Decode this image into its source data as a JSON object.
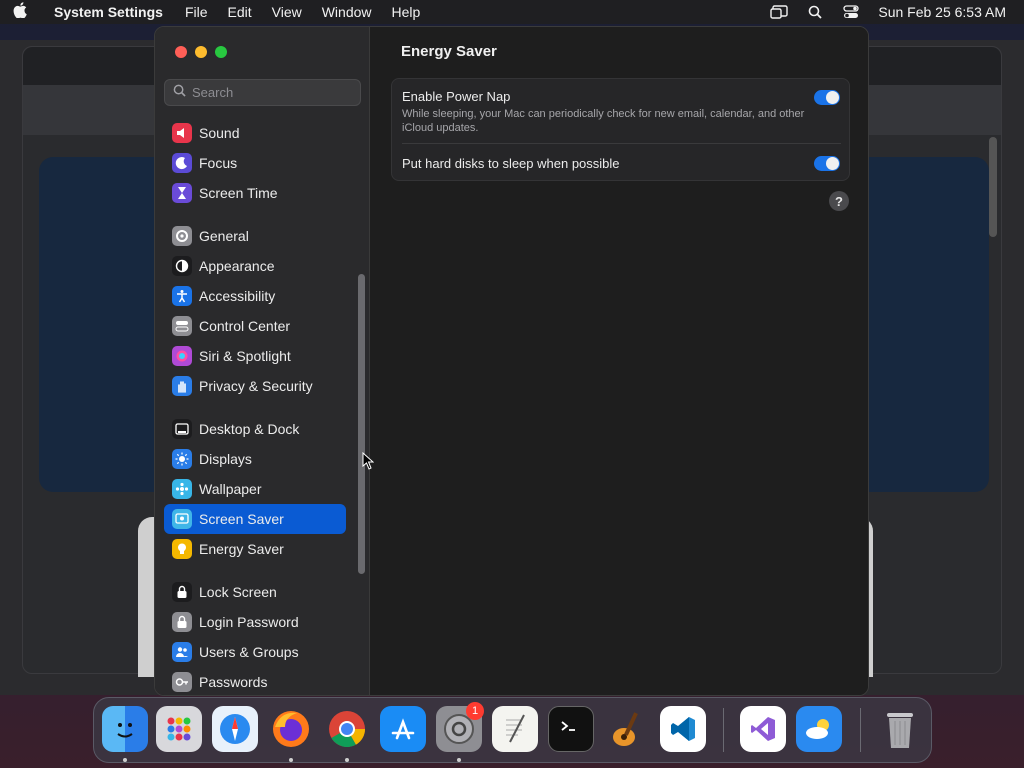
{
  "menubar": {
    "app_name": "System Settings",
    "menus": [
      "File",
      "Edit",
      "View",
      "Window",
      "Help"
    ],
    "clock": "Sun Feb 25  6:53 AM"
  },
  "sidebar": {
    "search_placeholder": "Search",
    "groups": [
      [
        {
          "label": "Sound",
          "icon": "speaker-icon",
          "color": "#e8354b"
        },
        {
          "label": "Focus",
          "icon": "moon-icon",
          "color": "#5b4bd6"
        },
        {
          "label": "Screen Time",
          "icon": "hourglass-icon",
          "color": "#6a4bd8"
        }
      ],
      [
        {
          "label": "General",
          "icon": "gear-icon",
          "color": "#8e8e93"
        },
        {
          "label": "Appearance",
          "icon": "appearance-icon",
          "color": "#1c1c1e"
        },
        {
          "label": "Accessibility",
          "icon": "accessibility-icon",
          "color": "#1a73e8"
        },
        {
          "label": "Control Center",
          "icon": "control-center-icon",
          "color": "#8e8e93"
        },
        {
          "label": "Siri & Spotlight",
          "icon": "siri-icon",
          "color": "#b04ad6"
        },
        {
          "label": "Privacy & Security",
          "icon": "hand-icon",
          "color": "#2a7de8"
        }
      ],
      [
        {
          "label": "Desktop & Dock",
          "icon": "dock-icon",
          "color": "#1c1c1e"
        },
        {
          "label": "Displays",
          "icon": "sun-icon",
          "color": "#2a7de8"
        },
        {
          "label": "Wallpaper",
          "icon": "wallpaper-icon",
          "color": "#38b6e8"
        },
        {
          "label": "Screen Saver",
          "icon": "screen-saver-icon",
          "color": "#3fb6e8",
          "active": true
        },
        {
          "label": "Energy Saver",
          "icon": "bulb-icon",
          "color": "#f5b800"
        }
      ],
      [
        {
          "label": "Lock Screen",
          "icon": "lock-icon",
          "color": "#1c1c1e"
        },
        {
          "label": "Login Password",
          "icon": "padlock-icon",
          "color": "#8e8e93"
        },
        {
          "label": "Users & Groups",
          "icon": "users-icon",
          "color": "#2a7de8"
        },
        {
          "label": "Passwords",
          "icon": "key-icon",
          "color": "#8e8e93"
        }
      ]
    ]
  },
  "main": {
    "title": "Energy Saver",
    "power_nap": {
      "title": "Enable Power Nap",
      "description": "While sleeping, your Mac can periodically check for new email, calendar, and other iCloud updates.",
      "enabled": true
    },
    "disk_sleep": {
      "title": "Put hard disks to sleep when possible",
      "enabled": true
    },
    "help": "?"
  },
  "dock": {
    "settings_badge": "1"
  }
}
